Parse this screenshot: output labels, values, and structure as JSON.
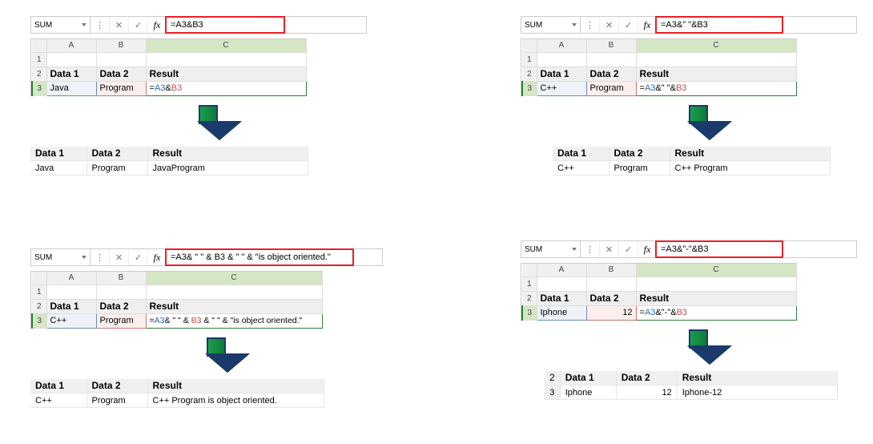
{
  "panels": [
    {
      "namebox": "SUM",
      "formula": "=A3&B3",
      "fbox_width": 150,
      "cols": [
        "A",
        "B",
        "C"
      ],
      "rows": [
        "1",
        "2",
        "3"
      ],
      "hdr": [
        "Data 1",
        "Data 2",
        "Result"
      ],
      "a3": "Java",
      "b3": "Program",
      "c3_prefix": "=",
      "c3_ref1": "A3",
      "c3_mid": "&",
      "c3_ref2": "B3",
      "c3_suffix": "",
      "result_hdr": [
        "Data 1",
        "Data 2",
        "Result"
      ],
      "result_row": [
        "Java",
        "Program",
        "JavaProgram"
      ]
    },
    {
      "namebox": "SUM",
      "formula": "=A3&\" \"&B3",
      "fbox_width": 160,
      "cols": [
        "A",
        "B",
        "C"
      ],
      "rows": [
        "1",
        "2",
        "3"
      ],
      "hdr": [
        "Data 1",
        "Data 2",
        "Result"
      ],
      "a3": "C++",
      "b3": "Program",
      "c3_prefix": "=",
      "c3_ref1": "A3",
      "c3_mid": "&\" \"&",
      "c3_ref2": "B3",
      "c3_suffix": "",
      "result_hdr": [
        "Data 1",
        "Data 2",
        "Result"
      ],
      "result_row": [
        "C++",
        "Program",
        "C++ Program"
      ]
    },
    {
      "namebox": "SUM",
      "formula": "=A3& \" \" & B3 & \" \" & \"is object oriented.\"",
      "fbox_width": 218,
      "cols": [
        "A",
        "B",
        "C"
      ],
      "rows": [
        "1",
        "2",
        "3"
      ],
      "hdr": [
        "Data 1",
        "Data 2",
        "Result"
      ],
      "a3": "C++",
      "b3": "Program",
      "c3_prefix": "=",
      "c3_ref1": "A3",
      "c3_mid": "& \" \" & ",
      "c3_ref2": "B3",
      "c3_suffix": " & \" \" & \"is object oriented.\"",
      "result_hdr": [
        "Data 1",
        "Data 2",
        "Result"
      ],
      "result_row": [
        "C++",
        "Program",
        "C++  Program is object oriented."
      ]
    },
    {
      "namebox": "SUM",
      "formula": "=A3&\"-\"&B3",
      "fbox_width": 160,
      "cols": [
        "A",
        "B",
        "C"
      ],
      "rows": [
        "1",
        "2",
        "3"
      ],
      "hdr": [
        "Data 1",
        "Data 2",
        "Result"
      ],
      "a3": "Iphone",
      "b3": "12",
      "b3_align": "right",
      "c3_prefix": "=",
      "c3_ref1": "A3",
      "c3_mid": "&\"-\"&",
      "c3_ref2": "B3",
      "c3_suffix": "",
      "result_hdr": [
        "Data 1",
        "Data 2",
        "Result"
      ],
      "result_row": [
        "Iphone",
        "12",
        "Iphone-12"
      ],
      "result_rowheaders": [
        "2",
        "3"
      ]
    }
  ],
  "icons": {
    "cancel": "✕",
    "enter": "✓",
    "fx": "fx"
  }
}
